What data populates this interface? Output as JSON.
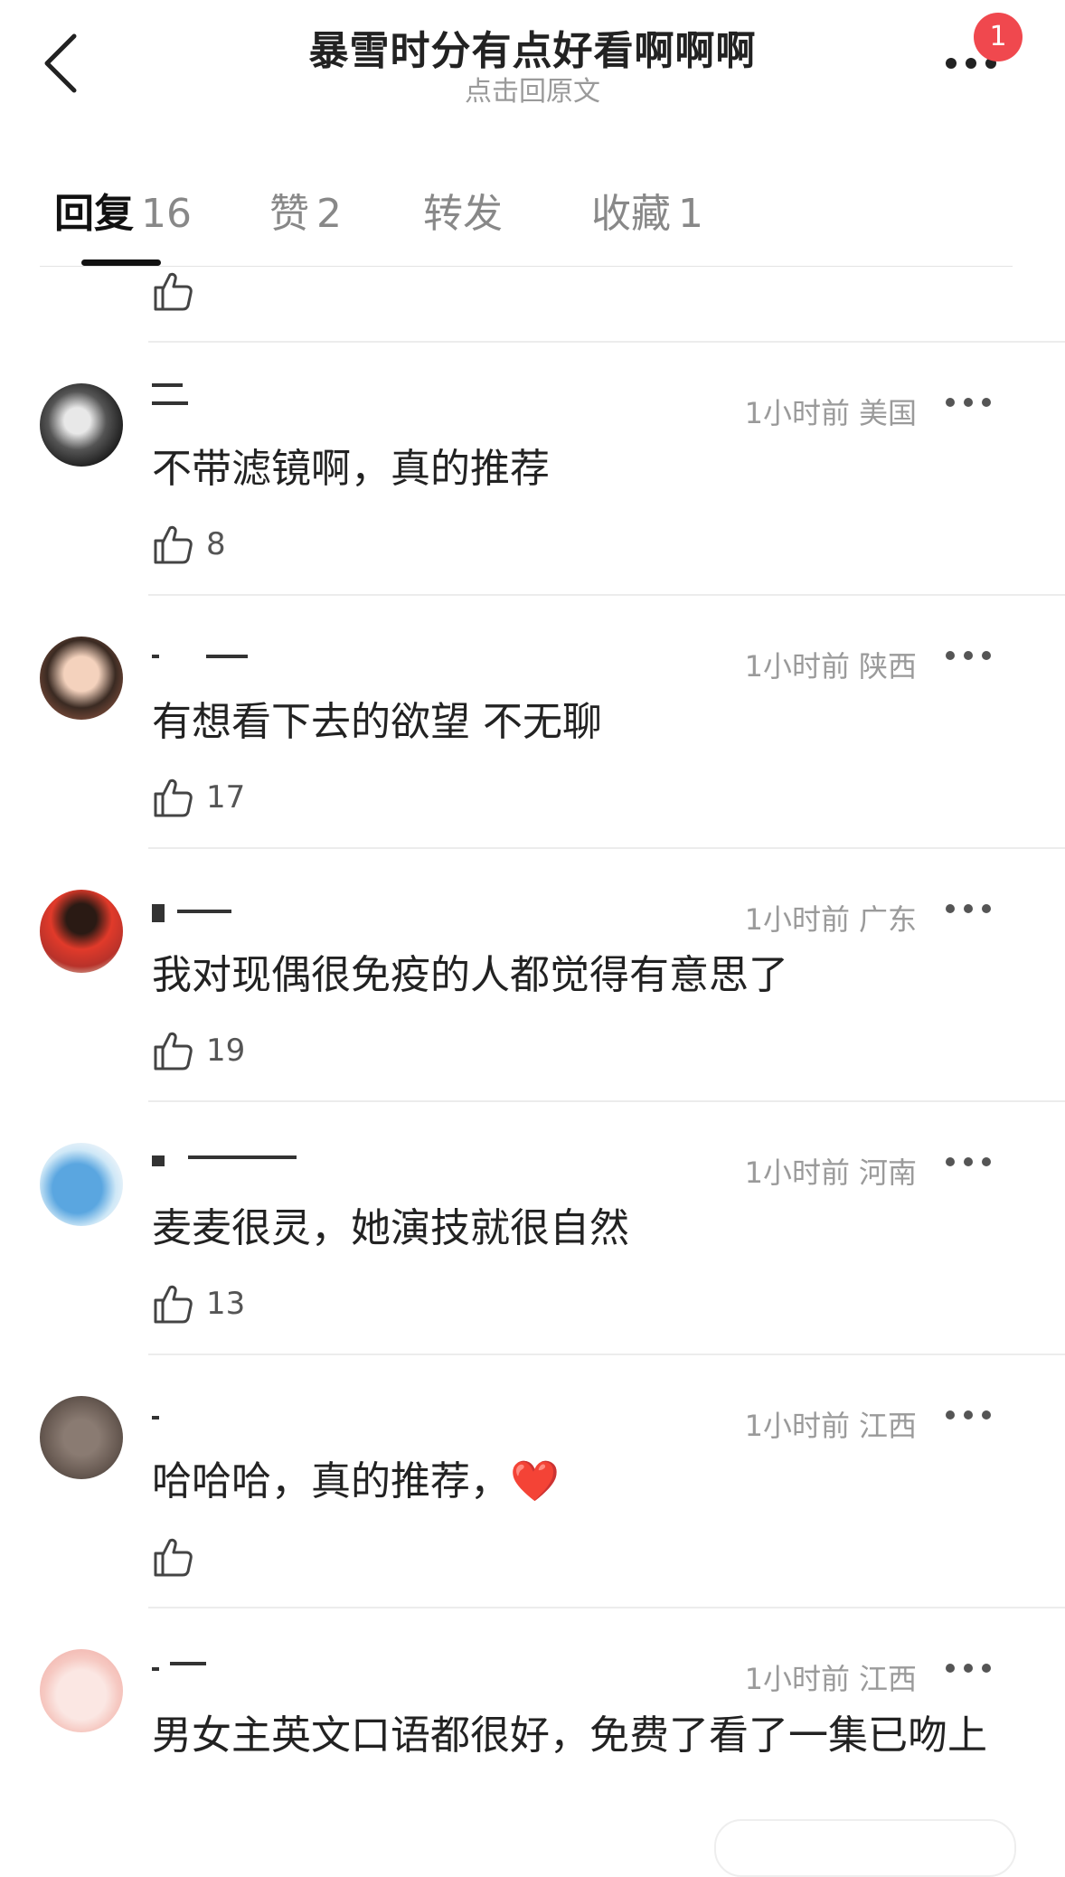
{
  "header": {
    "title": "暴雪时分有点好看啊啊啊",
    "subtitle": "点击回原文",
    "badge": "1"
  },
  "tabs": [
    {
      "label": "回复",
      "count": "16"
    },
    {
      "label": "赞",
      "count": "2"
    },
    {
      "label": "转发",
      "count": ""
    },
    {
      "label": "收藏",
      "count": "1"
    }
  ],
  "comments": [
    {
      "time": "1小时前",
      "location": "美国",
      "text": "不带滤镜啊，真的推荐",
      "likes": "8"
    },
    {
      "time": "1小时前",
      "location": "陕西",
      "text": "有想看下去的欲望 不无聊",
      "likes": "17"
    },
    {
      "time": "1小时前",
      "location": "广东",
      "text": "我对现偶很免疫的人都觉得有意思了",
      "likes": "19"
    },
    {
      "time": "1小时前",
      "location": "河南",
      "text": "麦麦很灵，她演技就很自然",
      "likes": "13"
    },
    {
      "time": "1小时前",
      "location": "江西",
      "text": "哈哈哈，真的推荐，❤️",
      "likes": ""
    },
    {
      "time": "1小时前",
      "location": "江西",
      "text": "男女主英文口语都很好，免费了看了一集已吻上",
      "likes": ""
    }
  ],
  "colors": {
    "badge": "#f0484e",
    "heart": "#e8222d",
    "muted": "#9a9a9a"
  },
  "icons": [
    "back-arrow-icon",
    "more-dots-icon",
    "thumbs-up-icon"
  ]
}
